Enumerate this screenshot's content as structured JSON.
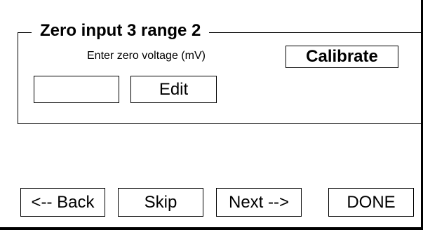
{
  "panel": {
    "title": "Zero input 3 range 2",
    "instruction": "Enter zero voltage (mV)",
    "calibrate_label": "Calibrate",
    "value": "",
    "edit_label": "Edit"
  },
  "nav": {
    "back_label": "<-- Back",
    "skip_label": "Skip",
    "next_label": "Next -->",
    "done_label": "DONE"
  }
}
